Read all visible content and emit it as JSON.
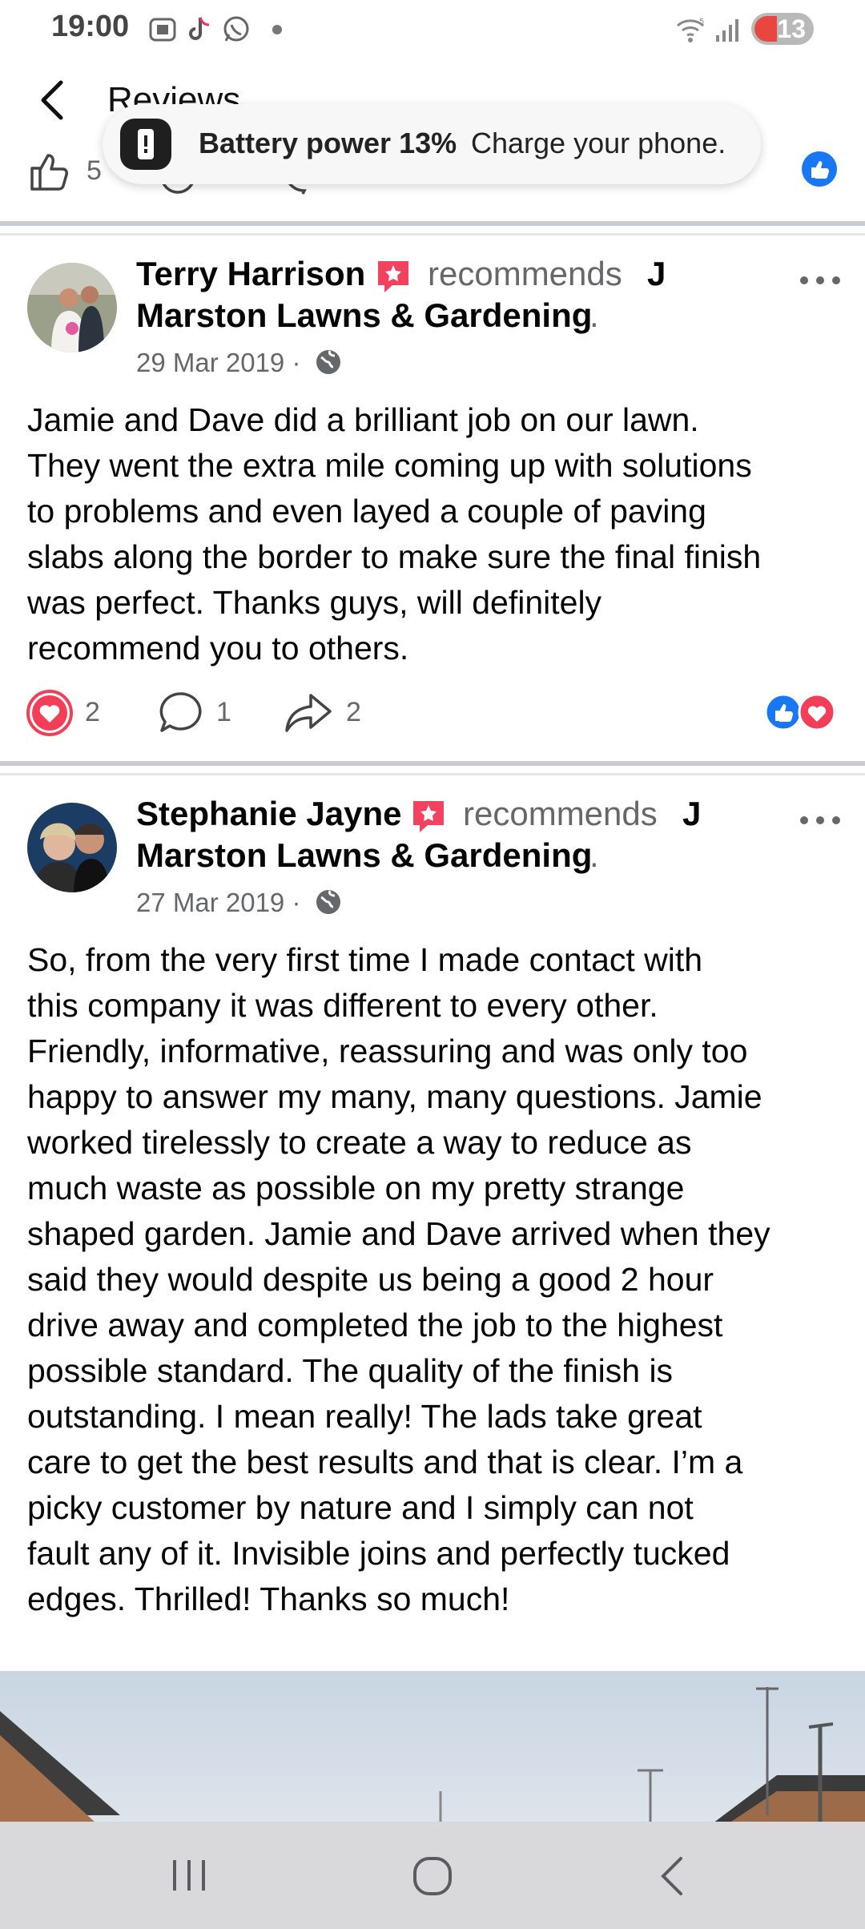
{
  "status_bar": {
    "time": "19:00",
    "battery_level": "13"
  },
  "header": {
    "title": "Reviews"
  },
  "toast": {
    "title": "Battery power 13%",
    "message": "Charge your phone."
  },
  "prev_post": {
    "like_count": "5"
  },
  "posts": [
    {
      "author": "Terry Harrison",
      "action": "recommends",
      "page_name_line1": "J",
      "page_name_line2": "Marston Lawns & Gardening",
      "page_period": ".",
      "date": "29 Mar 2019 · ",
      "body_lines": [
        "Jamie and Dave did a brilliant job on our lawn.",
        "They went the extra mile coming up with solutions",
        "to problems and even layed a couple of paving",
        "slabs along the border to make sure the final finish",
        "was perfect. Thanks guys, will definitely",
        "recommend you to others."
      ],
      "reactions": "2",
      "comments": "1",
      "shares": "2"
    },
    {
      "author": "Stephanie Jayne",
      "action": "recommends",
      "page_name_line1": "J",
      "page_name_line2": "Marston Lawns & Gardening",
      "page_period": ".",
      "date": "27 Mar 2019 · ",
      "body_lines": [
        "So, from the very first time I made contact with",
        "this company it was different to every other.",
        "Friendly, informative, reassuring and was only too",
        "happy to answer my many, many questions. Jamie",
        "worked tirelessly to create a way to reduce as",
        "much waste as possible on my pretty strange",
        "shaped garden. Jamie and Dave arrived when they",
        "said they would despite us being a good 2 hour",
        "drive away and completed the job to the highest",
        "possible standard. The quality of the finish is",
        "outstanding. I mean really! The lads take great",
        "care to get the best results and that is clear. I’m a",
        "picky customer by nature and I simply can not",
        "fault any of it. Invisible joins and perfectly tucked",
        "edges. Thrilled! Thanks so much!"
      ]
    }
  ],
  "colors": {
    "accent": "#1877f2",
    "love": "#f33e58",
    "secondary_text": "#65676b"
  }
}
